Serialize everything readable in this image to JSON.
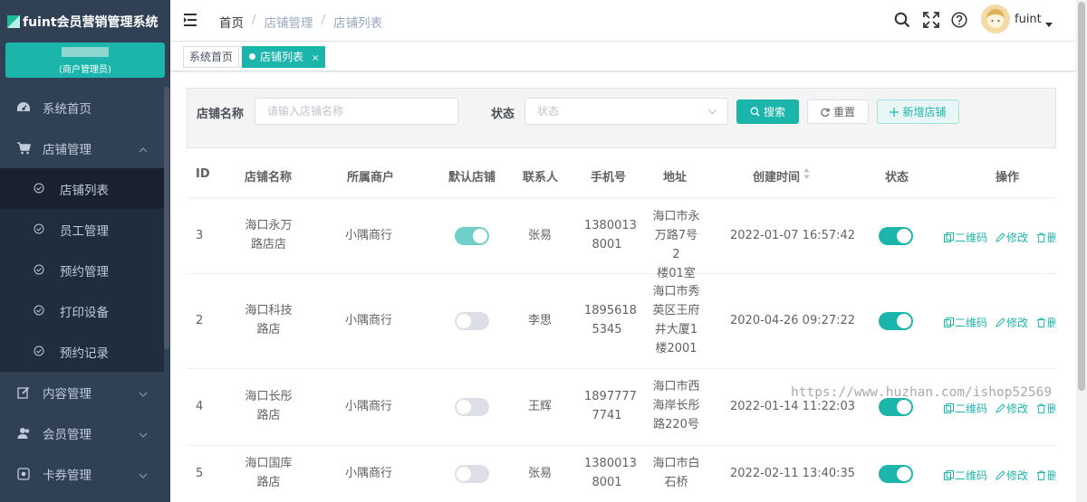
{
  "app": {
    "title": "fuint会员营销管理系统"
  },
  "user_card": {
    "role": "(商户管理员)"
  },
  "sidebar": {
    "items": [
      {
        "label": "系统首页",
        "icon": "dashboard-icon"
      },
      {
        "label": "店铺管理",
        "icon": "shopping-cart-icon",
        "expanded": true
      },
      {
        "label": "内容管理",
        "icon": "edit-icon"
      },
      {
        "label": "会员管理",
        "icon": "user-icon"
      },
      {
        "label": "卡券管理",
        "icon": "coupon-icon"
      }
    ],
    "subitems": [
      {
        "label": "店铺列表",
        "active": true
      },
      {
        "label": "员工管理"
      },
      {
        "label": "预约管理"
      },
      {
        "label": "打印设备"
      },
      {
        "label": "预约记录"
      }
    ]
  },
  "breadcrumb": [
    "首页",
    "店铺管理",
    "店铺列表"
  ],
  "header": {
    "username": "fuint"
  },
  "tags": [
    {
      "label": "系统首页",
      "active": false
    },
    {
      "label": "店铺列表",
      "active": true,
      "close": "×"
    }
  ],
  "search": {
    "store_label": "店铺名称",
    "store_placeholder": "请输入店铺名称",
    "status_label": "状态",
    "status_placeholder": "状态",
    "search_btn": "搜索",
    "reset_btn": "重置",
    "add_btn": "新增店铺"
  },
  "table": {
    "headers": [
      "ID",
      "店铺名称",
      "所属商户",
      "默认店铺",
      "联系人",
      "手机号",
      "地址",
      "创建时间",
      "状态",
      "操作"
    ],
    "rows": [
      {
        "id": "3",
        "name": [
          "海口永万",
          "路店店"
        ],
        "merchant": "小隅商行",
        "default": true,
        "contact": "张易",
        "phone": [
          "1380013",
          "8001"
        ],
        "address": [
          "海口市永",
          "万路7号2",
          "楼01室"
        ],
        "created": "2022-01-07 16:57:42",
        "status": true
      },
      {
        "id": "2",
        "name": [
          "海口科技",
          "路店"
        ],
        "merchant": "小隅商行",
        "default": false,
        "contact": "李思",
        "phone": [
          "1895618",
          "5345"
        ],
        "address": [
          "海口市秀",
          "英区王府",
          "井大厦1",
          "楼2001"
        ],
        "created": "2020-04-26 09:27:22",
        "status": true
      },
      {
        "id": "4",
        "name": [
          "海口长彤",
          "路店"
        ],
        "merchant": "小隅商行",
        "default": false,
        "contact": "王辉",
        "phone": [
          "1897777",
          "7741"
        ],
        "address": [
          "海口市西",
          "海岸长彤",
          "路220号"
        ],
        "created": "2022-01-14 11:22:03",
        "status": true
      },
      {
        "id": "5",
        "name": [
          "海口国库",
          "路店"
        ],
        "merchant": "小隅商行",
        "default": false,
        "contact": "张易",
        "phone": [
          "1380013",
          "8001"
        ],
        "address": [
          "海口市白",
          "石桥"
        ],
        "created": "2022-02-11 13:40:35",
        "status": true
      }
    ],
    "ops": {
      "qrcode": "二维码",
      "edit": "修改",
      "delete": "删除"
    }
  },
  "watermark": "https://www.huzhan.com/ishop52569",
  "colors": {
    "primary": "#1cb5ac",
    "sidebar": "#304156",
    "sidebar_sub": "#1f2d3d"
  }
}
